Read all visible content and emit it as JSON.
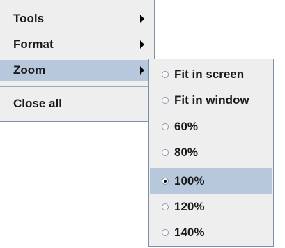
{
  "menu": {
    "items": [
      {
        "label": "Tools",
        "has_submenu": true,
        "selected": false
      },
      {
        "label": "Format",
        "has_submenu": true,
        "selected": false
      },
      {
        "label": "Zoom",
        "has_submenu": true,
        "selected": true
      },
      {
        "label": "Close all",
        "has_submenu": false,
        "selected": false
      }
    ]
  },
  "zoom_submenu": {
    "items": [
      {
        "label": "Fit in screen",
        "checked": false,
        "selected": false
      },
      {
        "label": "Fit in window",
        "checked": false,
        "selected": false
      },
      {
        "label": "60%",
        "checked": false,
        "selected": false
      },
      {
        "label": "80%",
        "checked": false,
        "selected": false
      },
      {
        "label": "100%",
        "checked": true,
        "selected": true
      },
      {
        "label": "120%",
        "checked": false,
        "selected": false
      },
      {
        "label": "140%",
        "checked": false,
        "selected": false
      }
    ]
  },
  "colors": {
    "menu_background": "#eeeeee",
    "selection_highlight": "#b8c8dc",
    "border": "#7f8fa8"
  },
  "icons": {
    "submenu_arrow": "chevron-right-icon",
    "radio_unchecked": "radio-unchecked-icon",
    "radio_checked": "radio-checked-icon"
  }
}
